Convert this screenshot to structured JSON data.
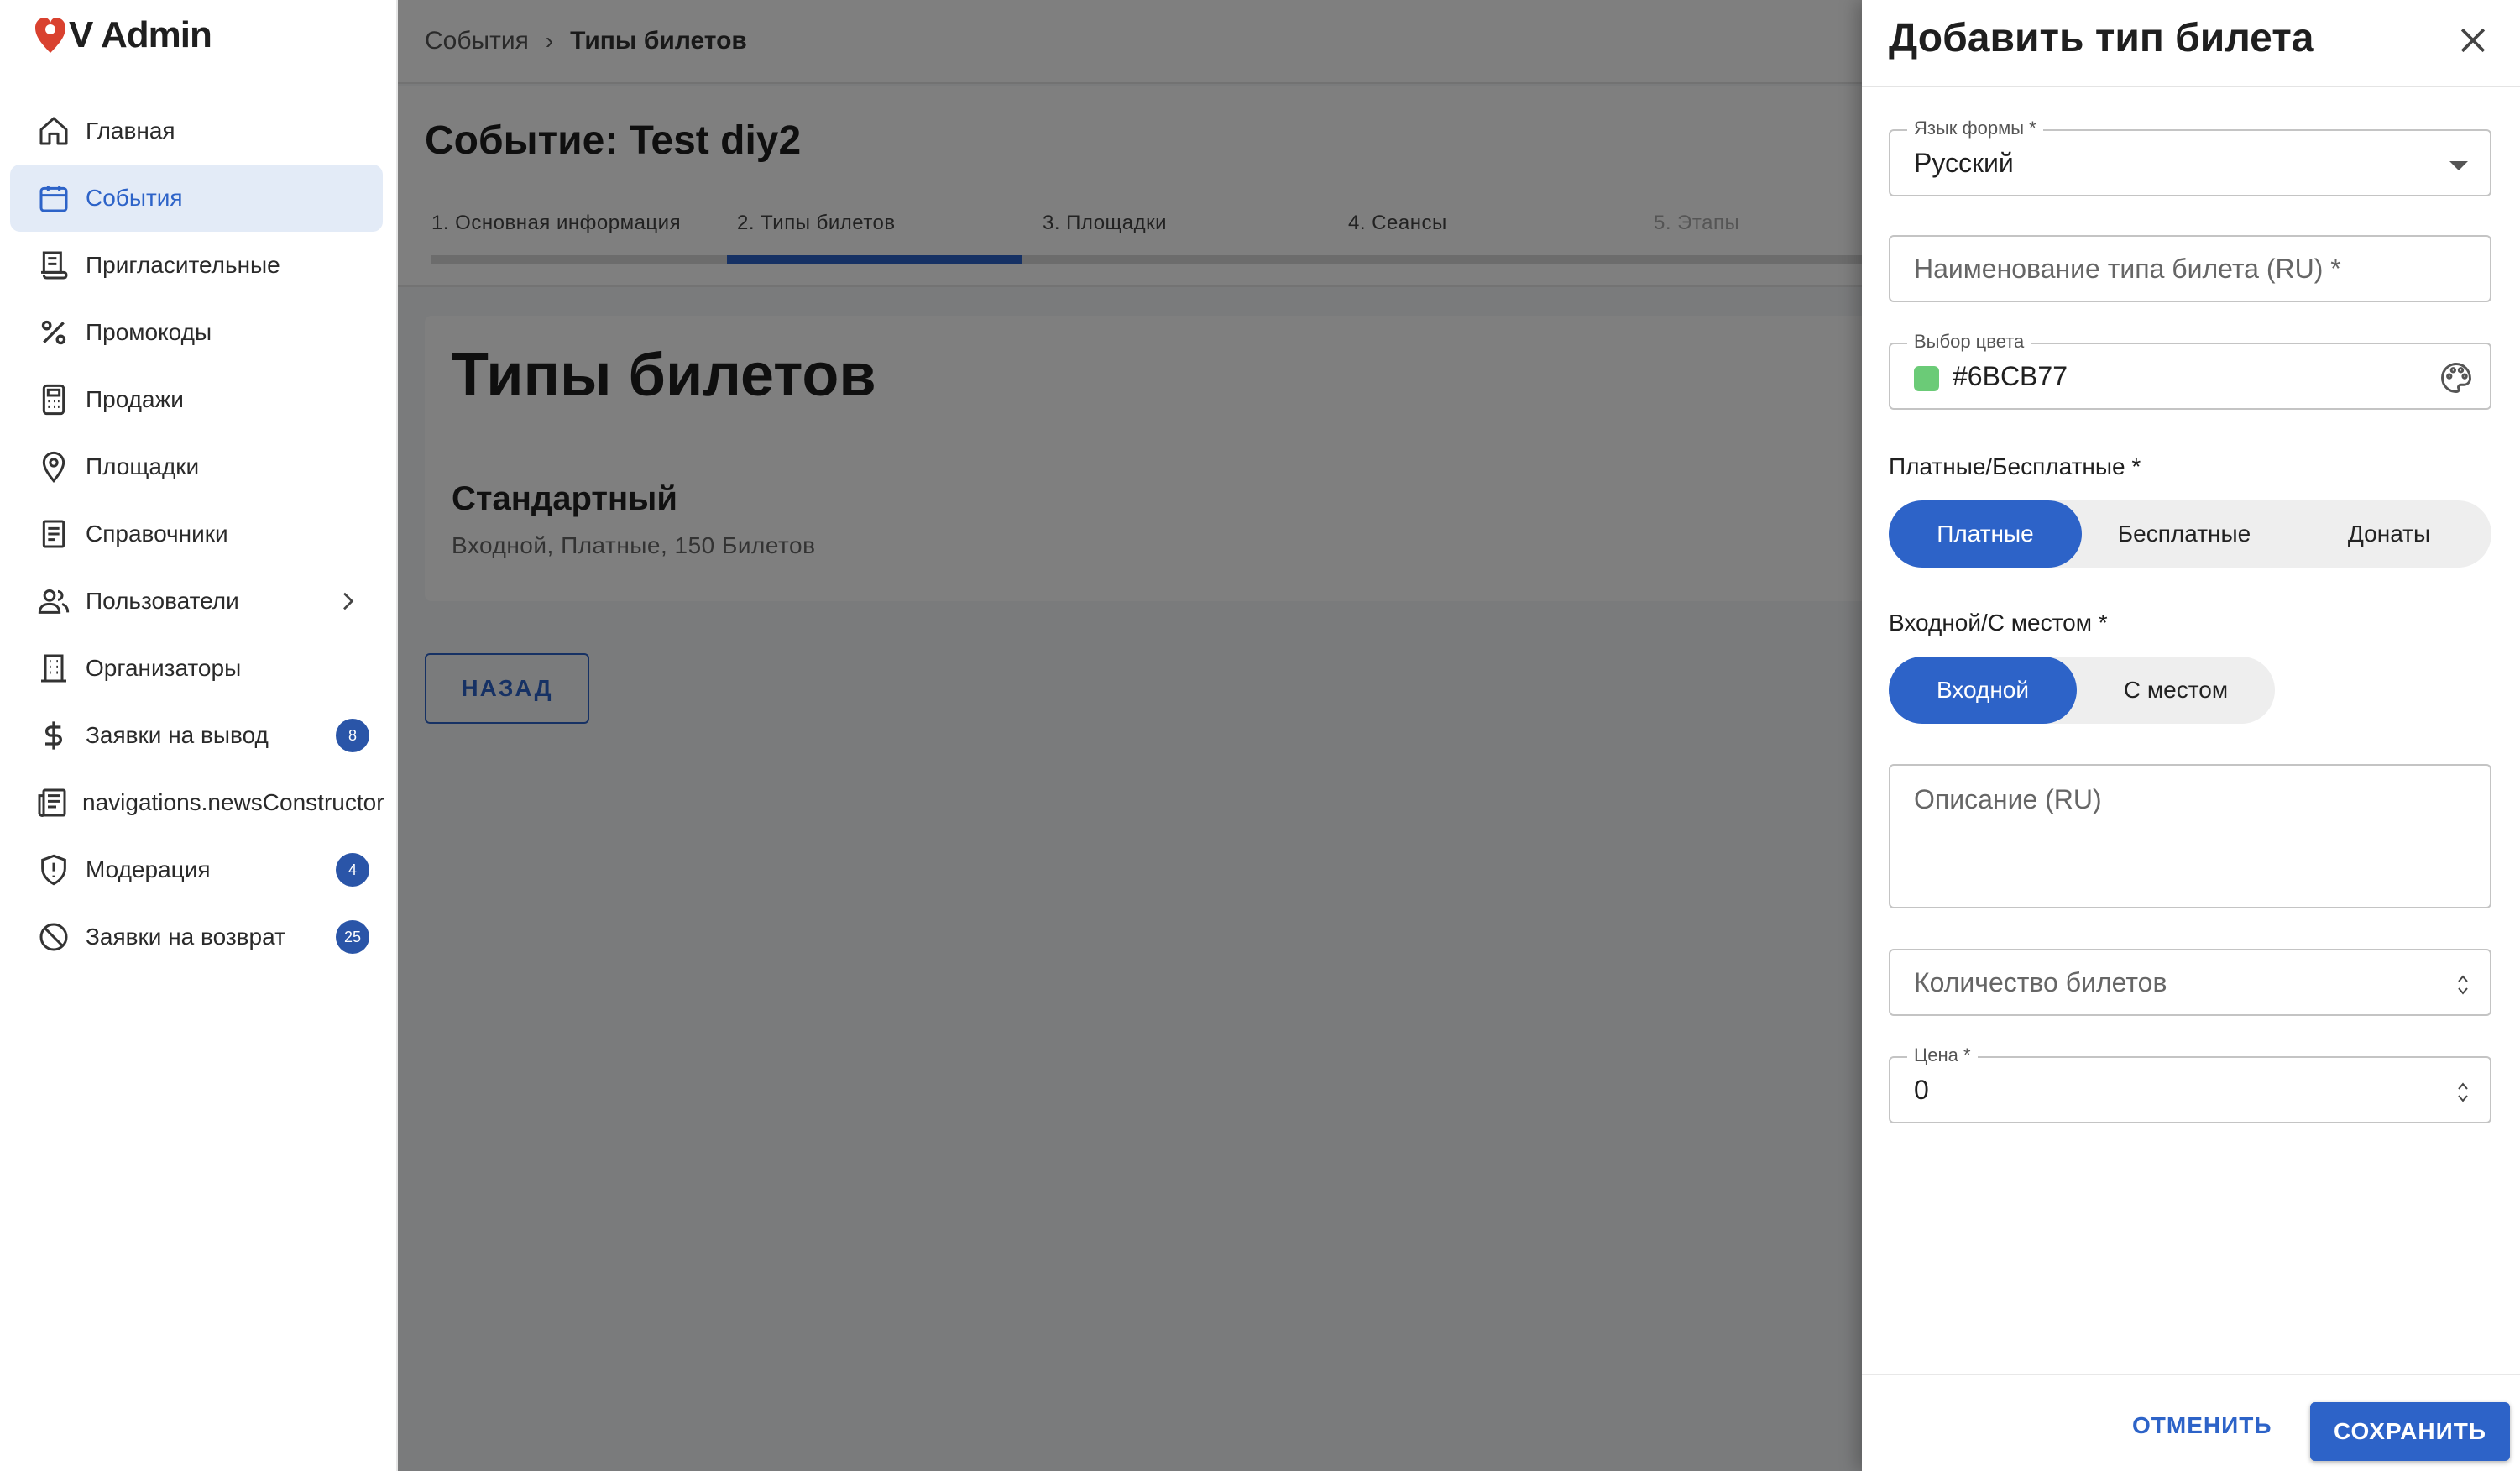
{
  "brand": {
    "name": "V Admin",
    "heart_color": "#d9412f"
  },
  "sidebar": {
    "items": [
      {
        "label": "Главная",
        "icon": "home-icon"
      },
      {
        "label": "События",
        "icon": "calendar-icon",
        "active": true
      },
      {
        "label": "Пригласительные",
        "icon": "invitation-icon"
      },
      {
        "label": "Промокоды",
        "icon": "percent-icon"
      },
      {
        "label": "Продажи",
        "icon": "calculator-icon"
      },
      {
        "label": "Площадки",
        "icon": "location-pin-icon"
      },
      {
        "label": "Справочники",
        "icon": "book-icon"
      },
      {
        "label": "Пользователи",
        "icon": "users-icon"
      },
      {
        "label": "Организаторы",
        "icon": "building-icon"
      },
      {
        "label": "Заявки на вывод",
        "icon": "dollar-icon",
        "badge": "8"
      },
      {
        "label": "navigations.newsConstructor",
        "icon": "newspaper-icon"
      },
      {
        "label": "Модерация",
        "icon": "shield-icon",
        "badge": "4"
      },
      {
        "label": "Заявки на возврат",
        "icon": "block-icon",
        "badge": "25"
      }
    ]
  },
  "breadcrumb": {
    "parent": "События",
    "separator": "›",
    "current": "Типы билетов"
  },
  "event": {
    "title": "Событие: Test diy2"
  },
  "steps": [
    {
      "label": "1. Основная информация"
    },
    {
      "label": "2. Типы билетов",
      "active": true
    },
    {
      "label": "3. Площадки"
    },
    {
      "label": "4. Сеансы"
    },
    {
      "label": "5. Этапы",
      "disabled": true
    }
  ],
  "ticket_types": {
    "title": "Типы билетов",
    "items": [
      {
        "name": "Стандартный",
        "meta": "Входной, Платные, 150 Билетов"
      }
    ]
  },
  "back_button": {
    "label": "НАЗАД"
  },
  "drawer": {
    "title": "Добавить тип билета",
    "form_language": {
      "label": "Язык формы *",
      "value": "Русский"
    },
    "name_field": {
      "placeholder": "Наименование типа билета (RU) *"
    },
    "color_field": {
      "label": "Выбор цвета",
      "value": "#6BCB77",
      "swatch": "#6BCB77"
    },
    "paid": {
      "label": "Платные/Бесплатные *",
      "options": [
        "Платные",
        "Бесплатные",
        "Донаты"
      ],
      "selected": 0
    },
    "seating": {
      "label": "Входной/С местом *",
      "options": [
        "Входной",
        "С местом"
      ],
      "selected": 0
    },
    "description": {
      "placeholder": "Описание (RU)"
    },
    "quantity": {
      "placeholder": "Количество билетов"
    },
    "price": {
      "label": "Цена *",
      "value": "0"
    },
    "cancel_label": "ОТМЕНИТЬ",
    "save_label": "СОХРАНИТЬ"
  },
  "colors": {
    "accent": "#2D63C8",
    "badge": "#2A55A8",
    "active_nav_bg": "#E3EBF7"
  }
}
